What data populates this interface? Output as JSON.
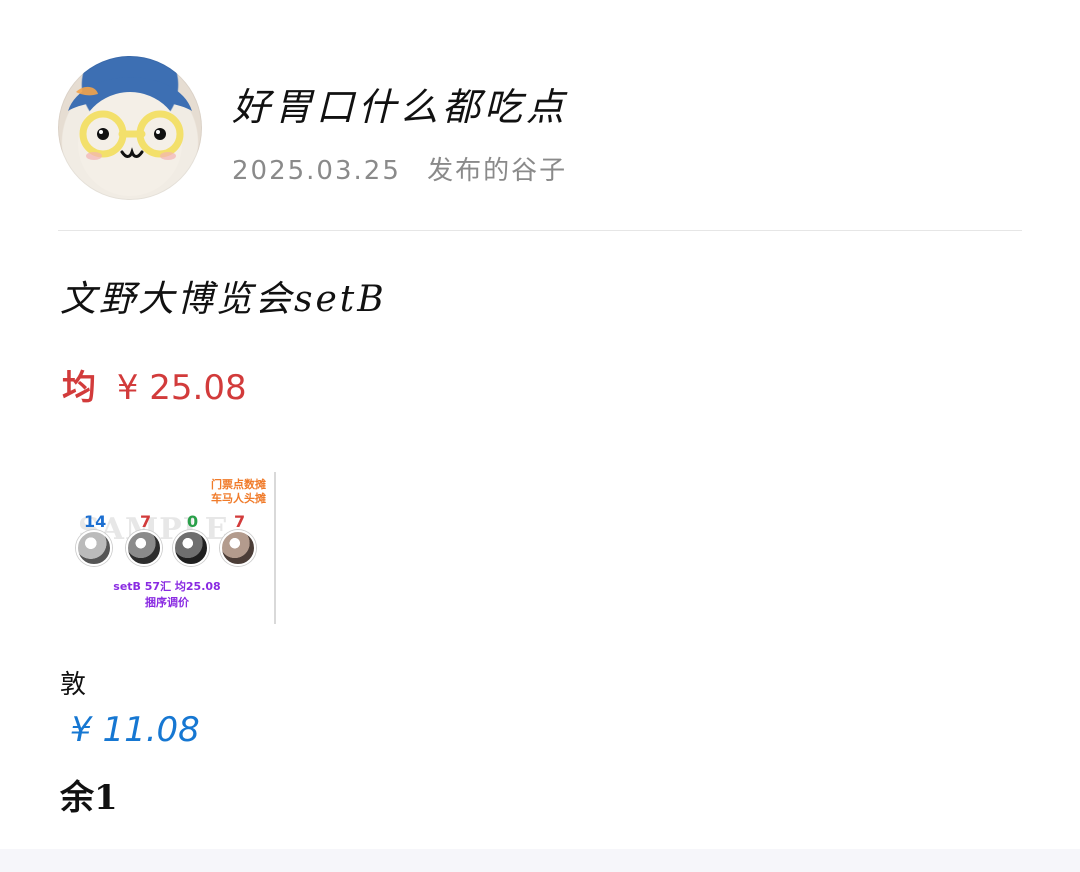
{
  "user": {
    "name": "好胃口什么都吃点",
    "date": "2025.03.25",
    "action": "发布的谷子"
  },
  "post": {
    "title": "文野大博览会setB",
    "avg_label": "均",
    "avg_price": "¥ 25.08",
    "image": {
      "top_note_1": "门票点数摊",
      "top_note_2": "车马人头摊",
      "watermark": "SAMPLE",
      "counts": [
        "14",
        "7",
        "0",
        "7"
      ],
      "caption_1": "setB 57汇 均25.08",
      "caption_2": "捆序调价"
    },
    "variant_label": "敦",
    "variant_price": "¥ 11.08",
    "remaining": "余1"
  },
  "colors": {
    "avg": "#d23b3b",
    "price": "#1677d2",
    "count_blue": "#1c6fd1",
    "count_red": "#d23b3b",
    "count_green": "#2aa04a",
    "caption": "#8a2be2",
    "note": "#f07b2a"
  },
  "icons": {
    "avatar": "avatar-illustration"
  }
}
